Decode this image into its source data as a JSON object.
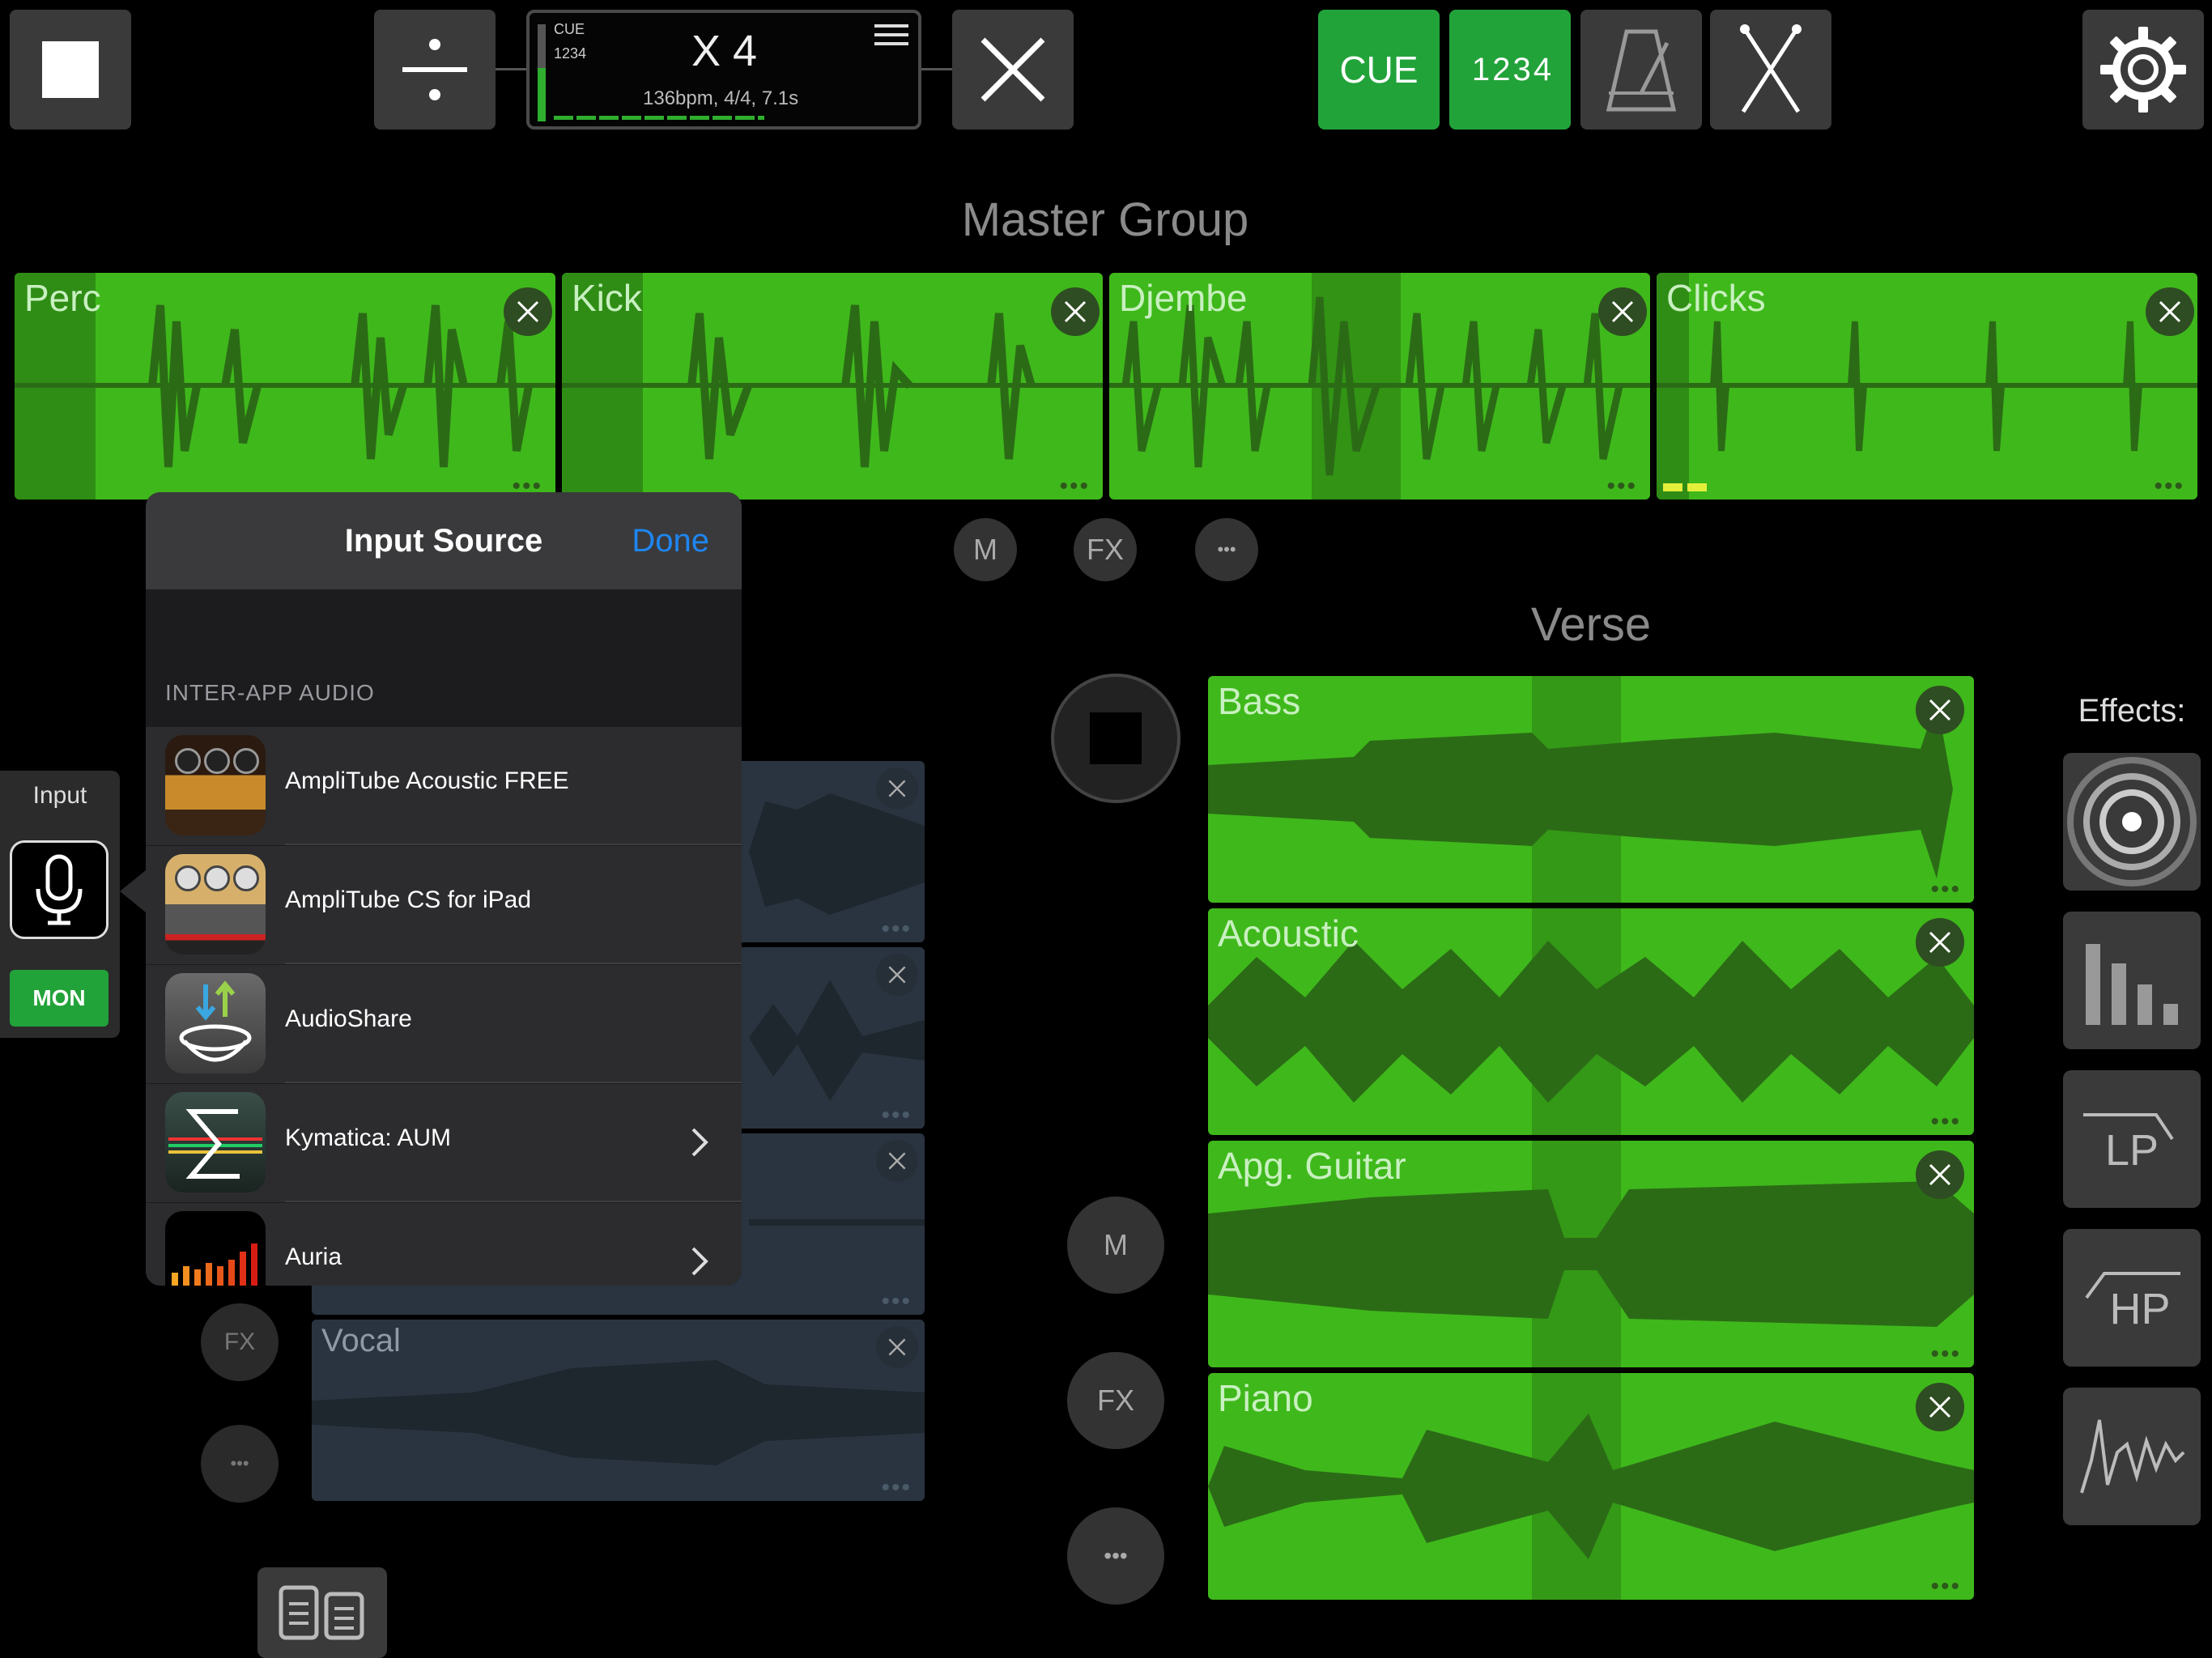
{
  "toolbar": {
    "cue_label": "CUE",
    "count_in_label": "1 2 3 4",
    "display": {
      "cue": "CUE",
      "pattern": "1234",
      "multiplier": "X 4",
      "tempo_info": "136bpm, 4/4, 7.1s"
    }
  },
  "master_group": {
    "title": "Master Group",
    "clips": [
      {
        "name": "Perc"
      },
      {
        "name": "Kick"
      },
      {
        "name": "Djembe"
      },
      {
        "name": "Clicks"
      }
    ],
    "buttons": {
      "mute": "M",
      "fx": "FX",
      "more": "•••"
    }
  },
  "verse_group": {
    "title": "Verse",
    "clips": [
      {
        "name": "Bass"
      },
      {
        "name": "Acoustic"
      },
      {
        "name": "Apg. Guitar"
      },
      {
        "name": "Piano"
      }
    ],
    "buttons": {
      "mute": "M",
      "fx": "FX",
      "more": "•••"
    }
  },
  "left_group": {
    "clips": [
      {
        "name": ""
      },
      {
        "name": ""
      },
      {
        "name": ""
      },
      {
        "name": "Vocal"
      }
    ],
    "buttons": {
      "fx": "FX",
      "more": "•••"
    }
  },
  "input_panel": {
    "label": "Input",
    "mon_label": "MON"
  },
  "popup": {
    "title": "Input Source",
    "done": "Done",
    "section": "INTER-APP AUDIO",
    "items": [
      {
        "label": "AmpliTube Acoustic FREE",
        "icon": "amplitube-acoustic-icon",
        "has_chevron": false
      },
      {
        "label": "AmpliTube CS for iPad",
        "icon": "amplitube-cs-icon",
        "has_chevron": false
      },
      {
        "label": "AudioShare",
        "icon": "audioshare-icon",
        "has_chevron": false
      },
      {
        "label": "Kymatica: AUM",
        "icon": "aum-icon",
        "has_chevron": true
      },
      {
        "label": "Auria",
        "icon": "auria-icon",
        "has_chevron": true
      }
    ]
  },
  "effects": {
    "title": "Effects:",
    "items": [
      {
        "name": "reverb",
        "label": ""
      },
      {
        "name": "eq",
        "label": ""
      },
      {
        "name": "lowpass",
        "label": "LP"
      },
      {
        "name": "highpass",
        "label": "HP"
      },
      {
        "name": "envelope",
        "label": ""
      }
    ]
  },
  "colors": {
    "clip_green": "#3fb81b",
    "button_green": "#22a33a",
    "link_blue": "#1e86f0"
  }
}
